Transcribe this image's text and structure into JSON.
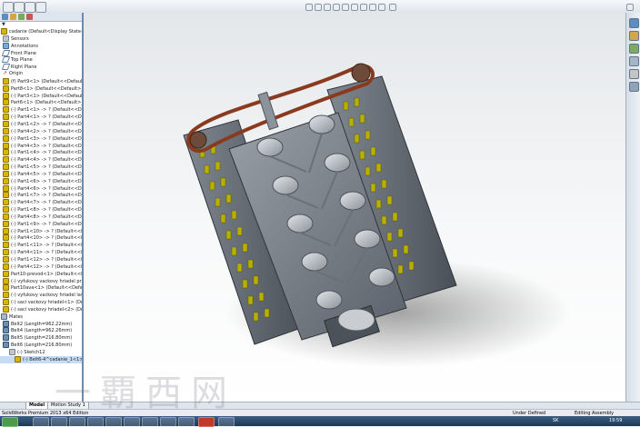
{
  "window": {
    "title": "SolidWorks Premium 2013 x64 Edition"
  },
  "toolbar": {
    "buttons": [
      "new-icon",
      "open-icon",
      "save-icon",
      "print-icon"
    ]
  },
  "feature_tree": {
    "filter_label": "",
    "items": [
      {
        "label": "cadanie  (Default<Display State-1>)",
        "icon": "assembly-icon",
        "level": "root"
      },
      {
        "label": "Sensors",
        "icon": "sensor-icon",
        "level": "d1"
      },
      {
        "label": "Annotations",
        "icon": "annotation-icon",
        "level": "d1"
      },
      {
        "label": "Front Plane",
        "icon": "plane-icon",
        "level": "d1"
      },
      {
        "label": "Top Plane",
        "icon": "plane-icon",
        "level": "d1"
      },
      {
        "label": "Right Plane",
        "icon": "plane-icon",
        "level": "d1"
      },
      {
        "label": "Origin",
        "icon": "origin-icon",
        "level": "d1"
      },
      {
        "label": "(f) Part9<1> (Default<<Default>_D",
        "icon": "part-icon",
        "level": "d1"
      },
      {
        "label": "Part8<1> (Default<<Default>_D",
        "icon": "part-icon",
        "level": "d1"
      },
      {
        "label": "(-) Part3<1> (Default<<Default>_D",
        "icon": "part-icon",
        "level": "d1"
      },
      {
        "label": "Part6<1> (Default<<Default>_D",
        "icon": "part-icon",
        "level": "d1"
      },
      {
        "label": "(-) Part1<1> -> ? (Default<<Defa",
        "icon": "part-icon",
        "level": "d1"
      },
      {
        "label": "(-) Part4<1> -> ? (Default<<Defa",
        "icon": "part-icon",
        "level": "d1"
      },
      {
        "label": "(-) Part1<2> -> ? (Default<<Defa",
        "icon": "part-icon",
        "level": "d1"
      },
      {
        "label": "(-) Part4<2> -> ? (Default<<Defa",
        "icon": "part-icon",
        "level": "d1"
      },
      {
        "label": "(-) Part1<3> -> ? (Default<<Defa",
        "icon": "part-icon",
        "level": "d1"
      },
      {
        "label": "(-) Part4<3> -> ? (Default<<Defa",
        "icon": "part-icon",
        "level": "d1"
      },
      {
        "label": "(-) Part1<4> -> ? (Default<<Defa",
        "icon": "part-icon",
        "level": "d1"
      },
      {
        "label": "(-) Part4<4> -> ? (Default<<Defa",
        "icon": "part-icon",
        "level": "d1"
      },
      {
        "label": "(-) Part1<5> -> ? (Default<<Defa",
        "icon": "part-icon",
        "level": "d1"
      },
      {
        "label": "(-) Part4<5> -> ? (Default<<Defa",
        "icon": "part-icon",
        "level": "d1"
      },
      {
        "label": "(-) Part1<6> -> ? (Default<<Defa",
        "icon": "part-icon",
        "level": "d1"
      },
      {
        "label": "(-) Part4<6> -> ? (Default<<Defa",
        "icon": "part-icon",
        "level": "d1"
      },
      {
        "label": "(-) Part1<7> -> ? (Default<<Defa",
        "icon": "part-icon",
        "level": "d1"
      },
      {
        "label": "(-) Part4<7> -> ? (Default<<Defa",
        "icon": "part-icon",
        "level": "d1"
      },
      {
        "label": "(-) Part1<8> -> ? (Default<<Defa",
        "icon": "part-icon",
        "level": "d1"
      },
      {
        "label": "(-) Part4<8> -> ? (Default<<Defa",
        "icon": "part-icon",
        "level": "d1"
      },
      {
        "label": "(-) Part1<9> -> ? (Default<<Defa",
        "icon": "part-icon",
        "level": "d1"
      },
      {
        "label": "(-) Part1<10> -> ? (Default<<Def",
        "icon": "part-icon",
        "level": "d1"
      },
      {
        "label": "(-) Part4<10> -> ? (Default<<Def",
        "icon": "part-icon",
        "level": "d1"
      },
      {
        "label": "(-) Part1<11> -> ? (Default<<Def",
        "icon": "part-icon",
        "level": "d1"
      },
      {
        "label": "(-) Part4<11> -> ? (Default<<Def",
        "icon": "part-icon",
        "level": "d1"
      },
      {
        "label": "(-) Part1<12> -> ? (Default<<Def",
        "icon": "part-icon",
        "level": "d1"
      },
      {
        "label": "(-) Part4<12> -> ? (Default<<Def",
        "icon": "part-icon",
        "level": "d1"
      },
      {
        "label": "Part10-prevod<1> (Default<<De",
        "icon": "part-icon",
        "level": "d1"
      },
      {
        "label": "(-) vyfukovy vackovy hriadel pra",
        "icon": "part-icon",
        "level": "d1"
      },
      {
        "label": "Part10ava<1> (Default<<Default",
        "icon": "part-icon",
        "level": "d1"
      },
      {
        "label": "(-) vyfukovy vackovy hriadel lav",
        "icon": "part-icon",
        "level": "d1"
      },
      {
        "label": "(-) saci vackovy hriadel<1> (Def",
        "icon": "part-icon",
        "level": "d1"
      },
      {
        "label": "(-) saci vackovy hriadel<2> (Def",
        "icon": "part-icon",
        "level": "d1"
      },
      {
        "label": "Mates",
        "icon": "mates-icon",
        "level": "root"
      },
      {
        "label": "Belt2 (Length=962.22mm)",
        "icon": "belt-icon",
        "level": "d1"
      },
      {
        "label": "Belt4 (Length=962.26mm)",
        "icon": "belt-icon",
        "level": "d1"
      },
      {
        "label": "Belt5 (Length=216.80mm)",
        "icon": "belt-icon",
        "level": "d1"
      },
      {
        "label": "Belt6 (Length=216.80mm)",
        "icon": "belt-icon",
        "level": "d1"
      },
      {
        "label": "(-) Sketch12",
        "icon": "sketch-icon",
        "level": "d2"
      },
      {
        "label": "(-) Belt6-4^cadanie_1<1> ->",
        "icon": "part-icon",
        "level": "d3",
        "selected": true
      }
    ]
  },
  "bottom_tabs": [
    {
      "label": "Model",
      "active": true
    },
    {
      "label": "Motion Study 1",
      "active": false
    }
  ],
  "status": {
    "left": "SolidWorks Premium 2013 x64 Edition",
    "underdefined": "Under Defined",
    "editing": "Editing Assembly",
    "lang": "SK",
    "time": "19:59"
  },
  "watermark": "一覇西网"
}
